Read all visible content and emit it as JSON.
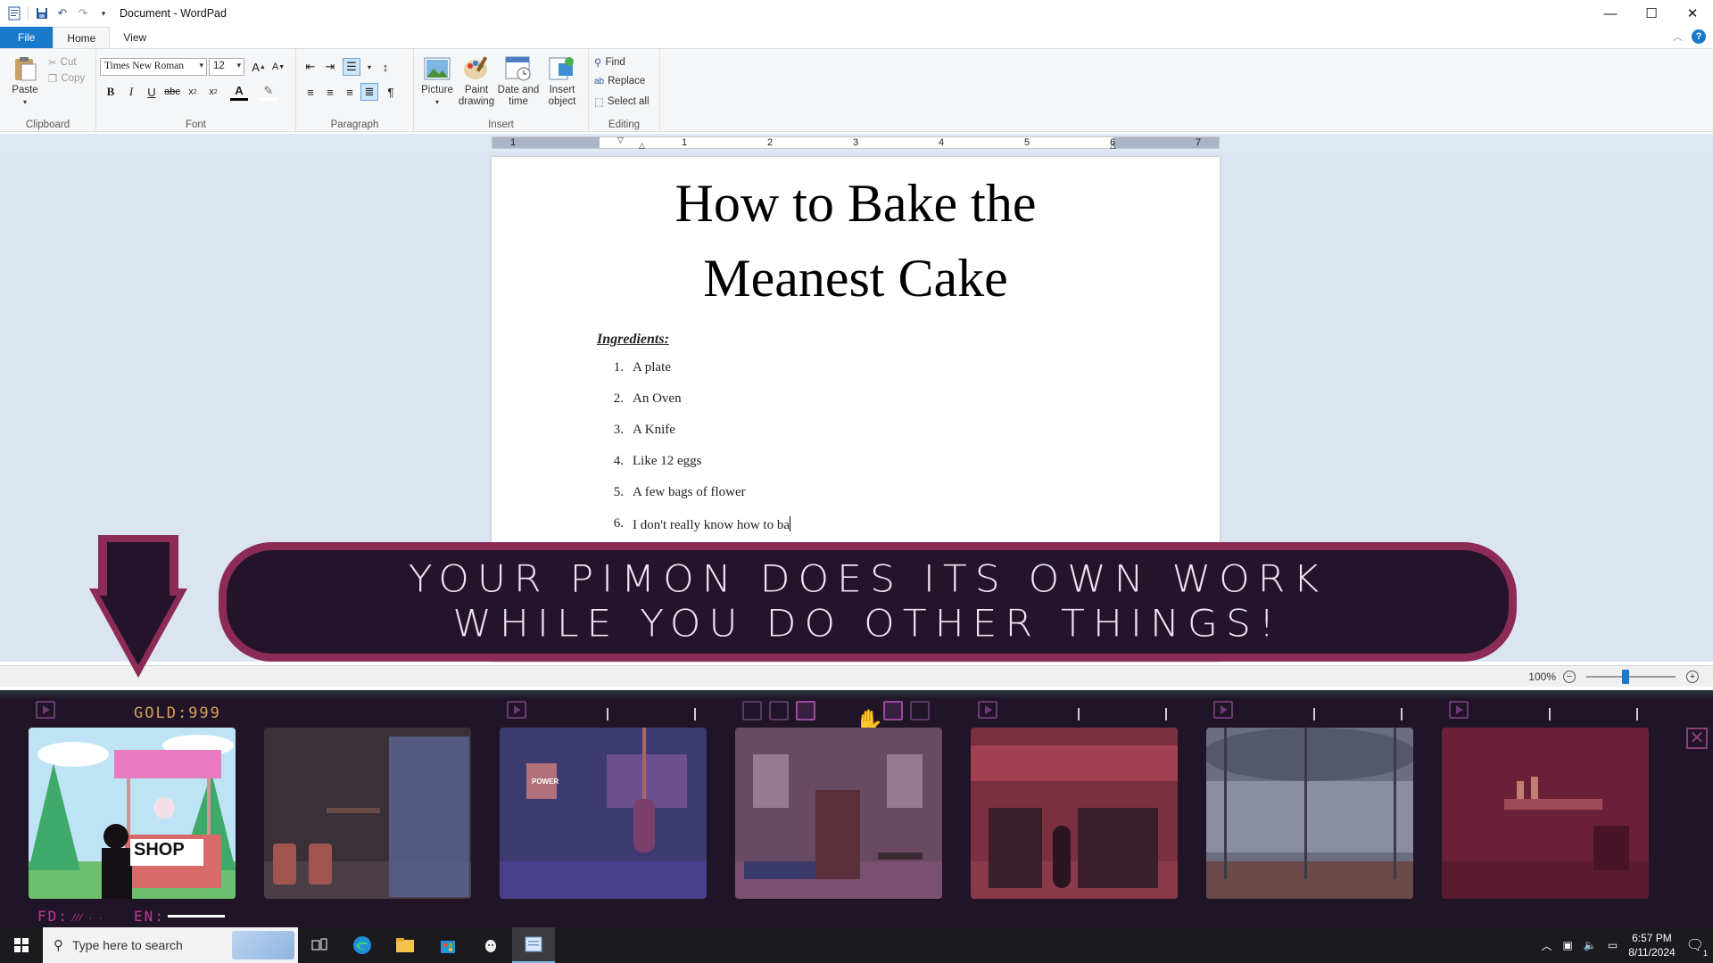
{
  "window": {
    "title": "Document - WordPad"
  },
  "tabs": {
    "file": "File",
    "home": "Home",
    "view": "View"
  },
  "ribbon": {
    "clipboard": {
      "label": "Clipboard",
      "paste": "Paste",
      "cut": "Cut",
      "copy": "Copy"
    },
    "font": {
      "label": "Font",
      "family": "Times New Roman",
      "size": "12"
    },
    "paragraph": {
      "label": "Paragraph"
    },
    "insert": {
      "label": "Insert",
      "picture": "Picture",
      "paint_line1": "Paint",
      "paint_line2": "drawing",
      "date_line1": "Date and",
      "date_line2": "time",
      "object_line1": "Insert",
      "object_line2": "object"
    },
    "editing": {
      "label": "Editing",
      "find": "Find",
      "replace": "Replace",
      "select_all": "Select all"
    }
  },
  "ruler": {
    "numbers": [
      "1",
      "1",
      "2",
      "3",
      "4",
      "5",
      "6",
      "7"
    ]
  },
  "document": {
    "title_line1": "How to Bake the",
    "title_line2": "Meanest Cake",
    "ingredients_heading": "Ingredients:",
    "items": [
      {
        "num": "1.",
        "text": "A plate"
      },
      {
        "num": "2.",
        "text": "An Oven"
      },
      {
        "num": "3.",
        "text": "A Knife"
      },
      {
        "num": "4.",
        "text": "Like 12 eggs"
      },
      {
        "num": "5.",
        "text": "A few bags of flower"
      },
      {
        "num": "6.",
        "text": "I don't really know how to ba"
      }
    ]
  },
  "statusbar": {
    "zoom": "100%"
  },
  "game": {
    "banner_line1": "YOUR PIMON DOES ITS OWN WORK",
    "banner_line2": "WHILE YOU DO OTHER THINGS!",
    "gold": "GOLD:999",
    "fd_label": "FD:",
    "en_label": "EN:",
    "shop_sign": "SHOP",
    "poster": "POWER"
  },
  "taskbar": {
    "search_placeholder": "Type here to search",
    "time": "6:57 PM",
    "date": "8/11/2024",
    "notifications": "1"
  }
}
